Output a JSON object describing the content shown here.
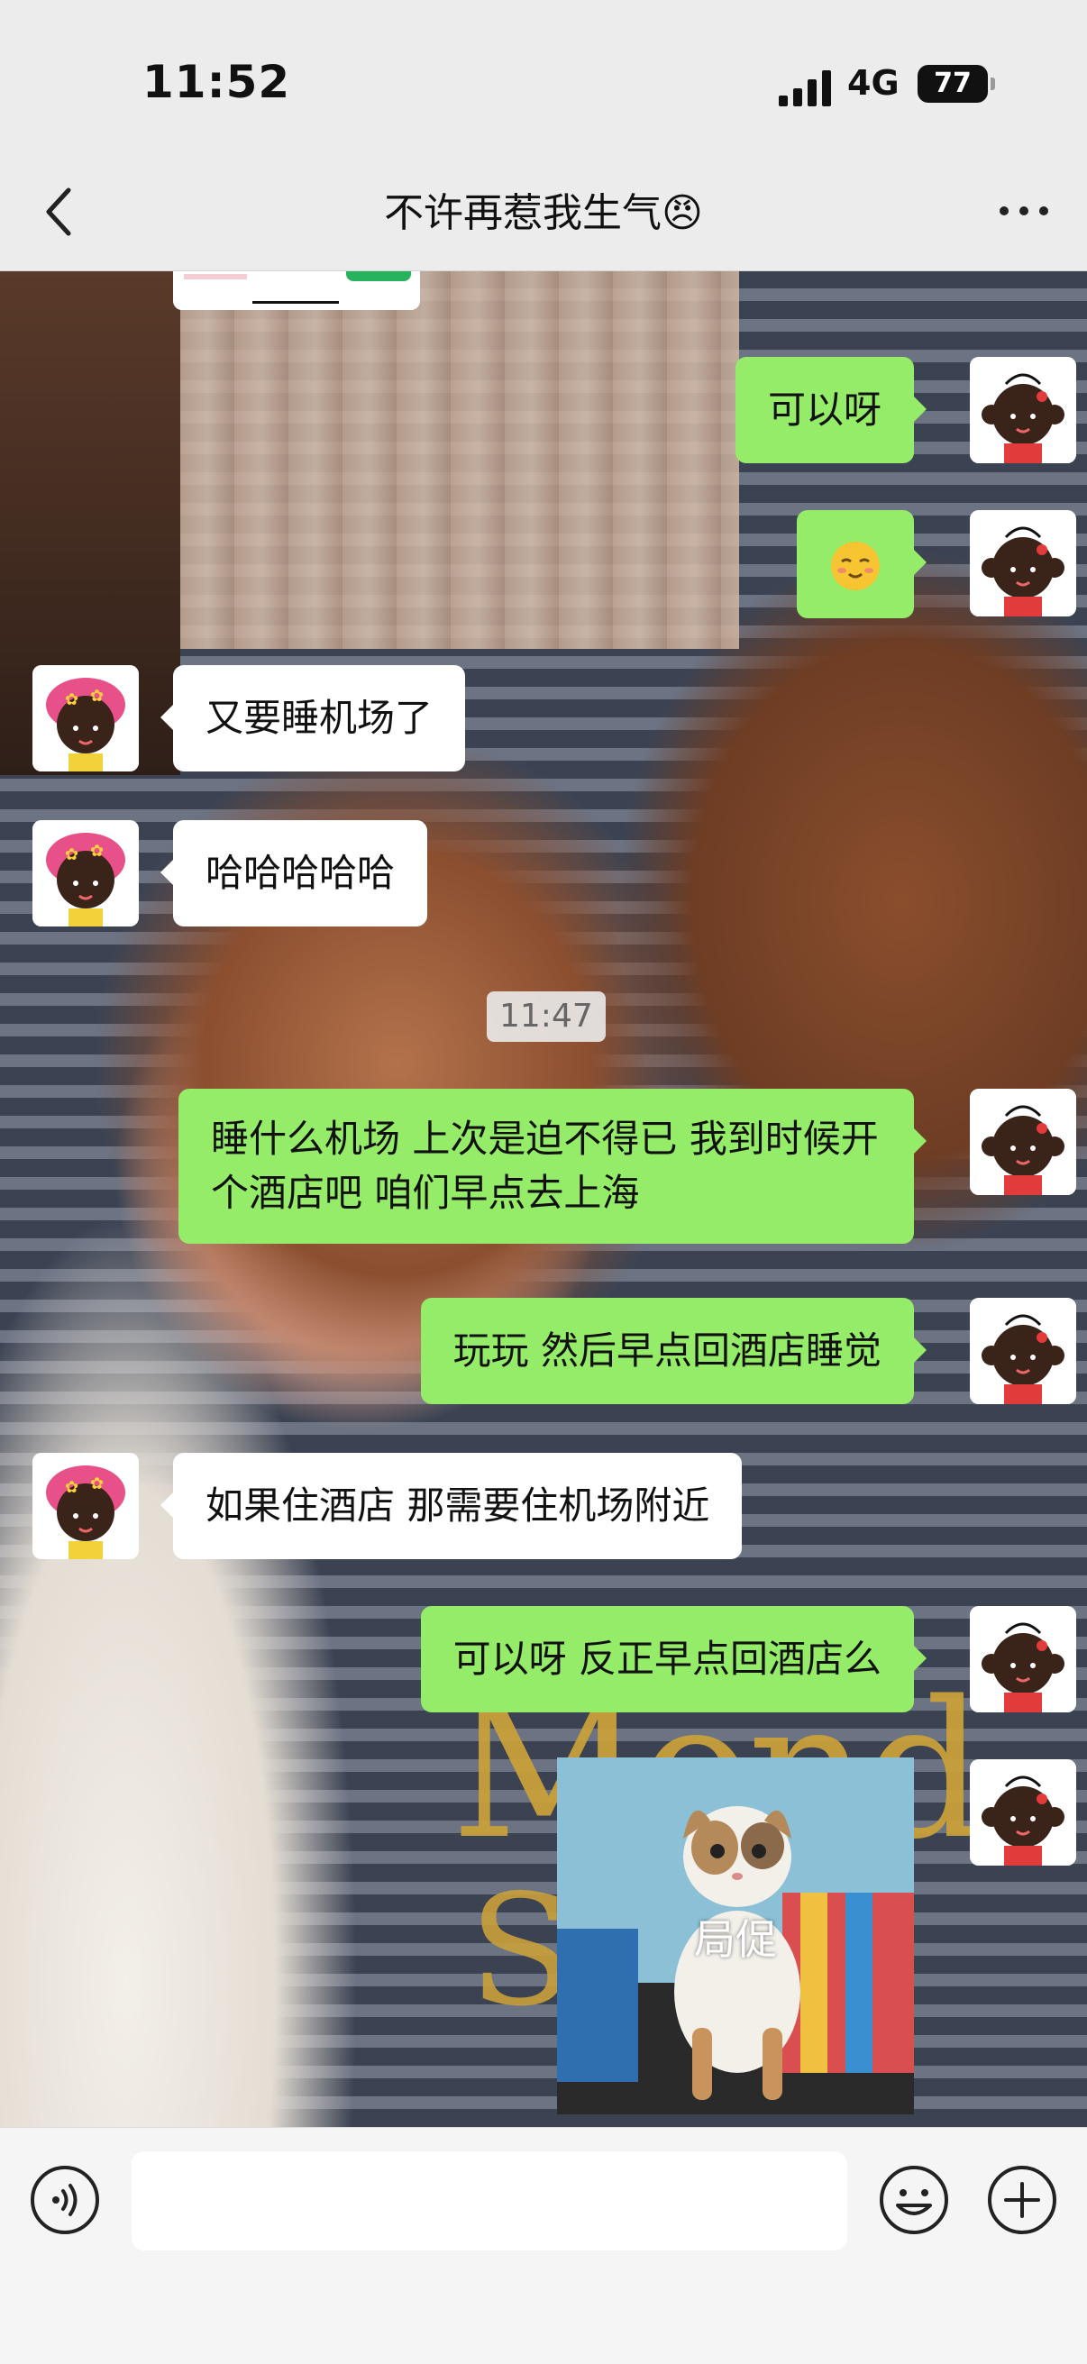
{
  "status_bar": {
    "time": "11:52",
    "network": "4G",
    "battery": "77"
  },
  "nav": {
    "title": "不许再惹我生气😠"
  },
  "messages": [
    {
      "side": "out",
      "text": "可以呀"
    },
    {
      "side": "out",
      "text": "",
      "emoji": "blushing-smile"
    },
    {
      "side": "in",
      "text": "又要睡机场了"
    },
    {
      "side": "in",
      "text": "哈哈哈哈哈"
    },
    {
      "side": "out",
      "text": "睡什么机场 上次是迫不得已 我到时候开个酒店吧 咱们早点去上海"
    },
    {
      "side": "out",
      "text": "玩玩 然后早点回酒店睡觉"
    },
    {
      "side": "in",
      "text": "如果住酒店 那需要住机场附近"
    },
    {
      "side": "out",
      "text": "可以呀 反正早点回酒店么"
    }
  ],
  "timestamp": "11:47",
  "sticker": {
    "caption": "局促"
  },
  "colors": {
    "out_bubble": "#95ec69",
    "in_bubble": "#ffffff"
  }
}
